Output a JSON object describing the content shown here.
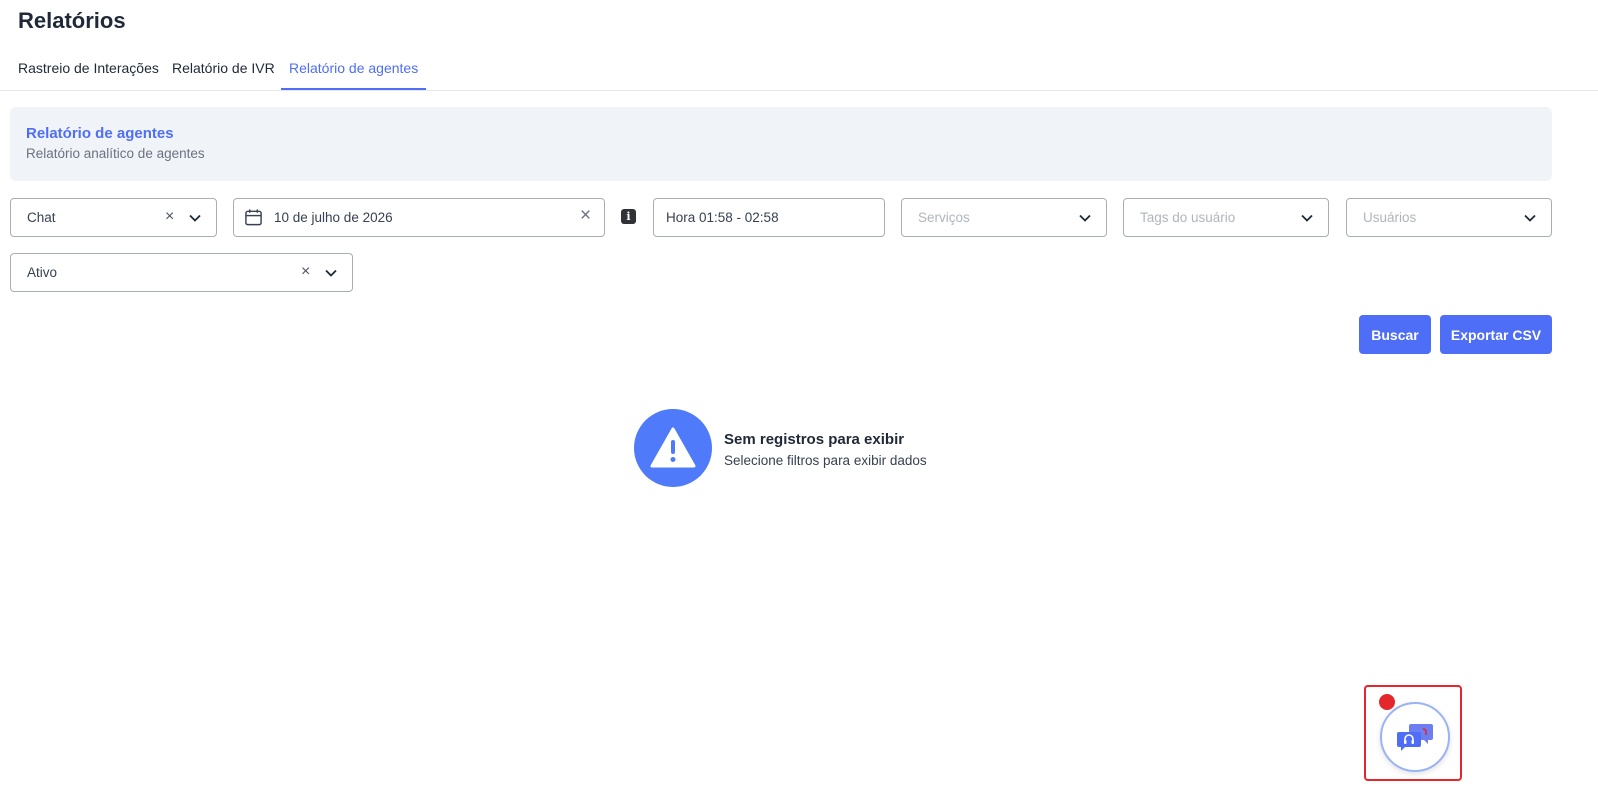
{
  "page": {
    "title": "Relatórios"
  },
  "tabs": [
    {
      "label": "Rastreio de Interações",
      "active": false
    },
    {
      "label": "Relatório de IVR",
      "active": false
    },
    {
      "label": "Relatório de agentes",
      "active": true
    }
  ],
  "banner": {
    "title": "Relatório de agentes",
    "subtitle": "Relatório analítico de agentes"
  },
  "filters": {
    "channel": {
      "value": "Chat"
    },
    "date": {
      "value": "10 de julho de 2026"
    },
    "time": {
      "value": "Hora 01:58 - 02:58"
    },
    "services": {
      "placeholder": "Serviços"
    },
    "user_tags": {
      "placeholder": "Tags do usuário"
    },
    "users": {
      "placeholder": "Usuários"
    },
    "status": {
      "value": "Ativo"
    }
  },
  "actions": {
    "search_label": "Buscar",
    "export_label": "Exportar CSV"
  },
  "empty_state": {
    "title": "Sem registros para exibir",
    "subtitle": "Selecione filtros para exibir dados"
  },
  "colors": {
    "accent": "#4f6ef7",
    "banner_bg": "#f0f3f8",
    "notification": "#e5262b"
  },
  "icons": {
    "calendar": "calendar-icon",
    "info": "info-icon",
    "warning": "warning-icon",
    "chat_support": "chat-support-icon"
  }
}
